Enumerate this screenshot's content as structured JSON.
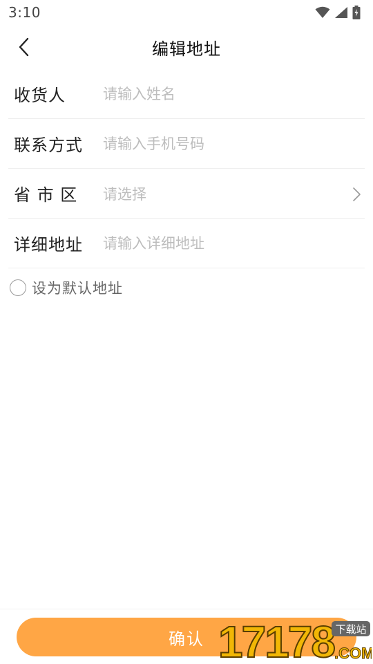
{
  "status_bar": {
    "time": "3:10",
    "icons": [
      "wifi-icon",
      "signal-icon",
      "battery-charging-icon"
    ]
  },
  "nav": {
    "back_icon": "chevron-left-icon",
    "title": "编辑地址"
  },
  "form": {
    "recipient": {
      "label": "收货人",
      "placeholder": "请输入姓名"
    },
    "phone": {
      "label": "联系方式",
      "placeholder": "请输入手机号码"
    },
    "region": {
      "label": "省 市 区",
      "value": "请选择",
      "icon": "chevron-right-icon"
    },
    "address": {
      "label": "详细地址",
      "placeholder": "请输入详细地址"
    }
  },
  "default_option": {
    "label": "设为默认地址",
    "checked": false
  },
  "confirm_button": {
    "label": "确认",
    "color": "#ffa645"
  },
  "watermark": {
    "text": "17178",
    "sub": "下载站",
    "com": ".COM"
  },
  "colors": {
    "accent": "#ffa645",
    "placeholder": "#bdbdbd",
    "divider": "#eeeeee"
  }
}
